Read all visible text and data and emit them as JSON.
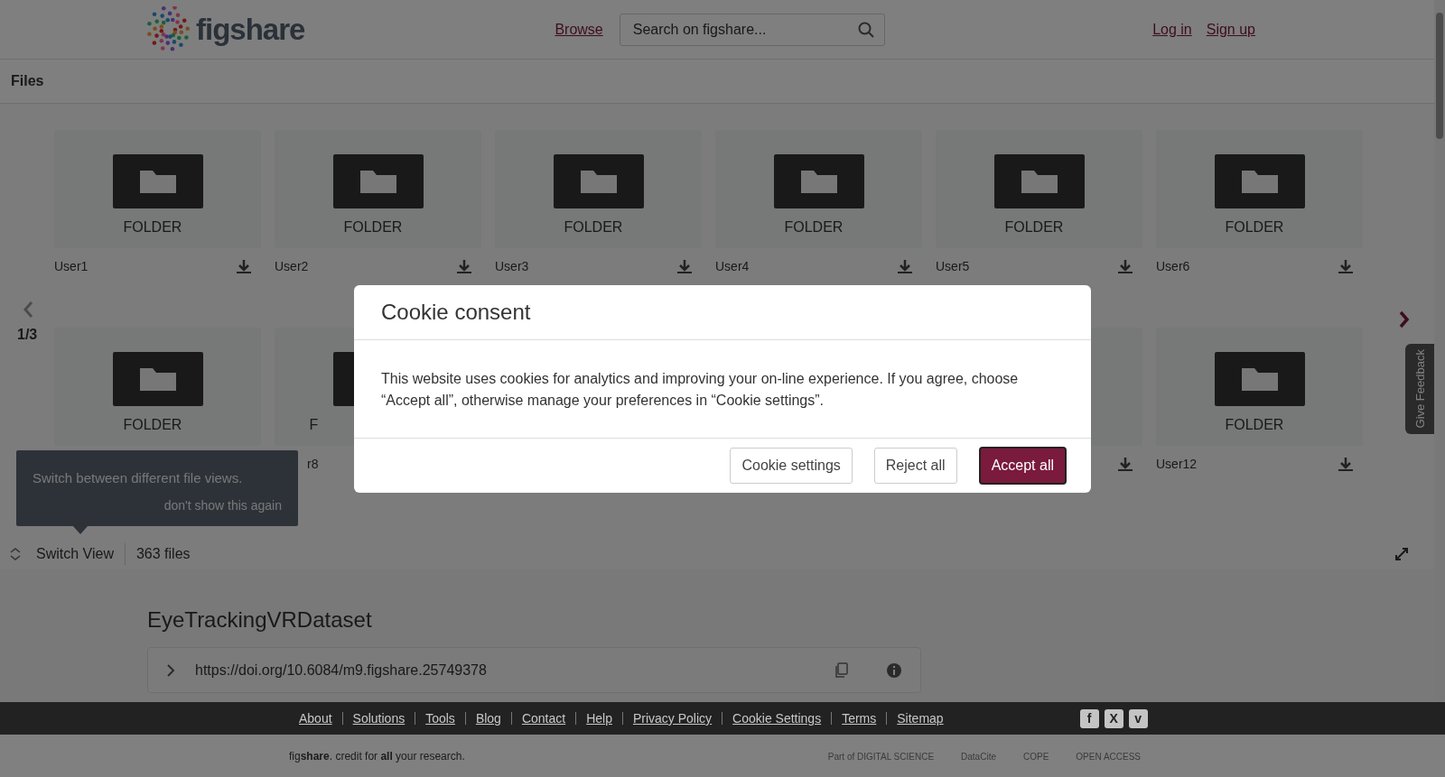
{
  "header": {
    "logo_text": "figshare",
    "nav_link": "Browse",
    "search": {
      "placeholder": "Search on figshare..."
    },
    "auth_links": [
      "Log in",
      "Sign up"
    ]
  },
  "files_bar": {
    "title": "Files"
  },
  "carousel": {
    "page": "1/3",
    "rows": [
      [
        {
          "kind": "folder",
          "caption": "FOLDER",
          "label": "User1",
          "download": true
        },
        {
          "kind": "folder",
          "caption": "FOLDER",
          "label": "User2",
          "download": true
        },
        {
          "kind": "folder",
          "caption": "FOLDER",
          "label": "User3",
          "download": true
        },
        {
          "kind": "folder",
          "caption": "FOLDER",
          "label": "User4",
          "download": true
        },
        {
          "kind": "folder",
          "caption": "FOLDER",
          "label": "User5",
          "download": true
        },
        {
          "kind": "folder",
          "caption": "FOLDER",
          "label": "User6",
          "download": true
        }
      ],
      [
        {
          "kind": "folder",
          "caption": "FOLDER"
        },
        {
          "kind": "folder-clipped",
          "caption": "F",
          "label": "r8"
        },
        {
          "kind": "hidden"
        },
        {
          "kind": "hidden"
        },
        {
          "kind": "blank",
          "download": true
        },
        {
          "kind": "folder",
          "caption": "FOLDER",
          "label": "User12",
          "download": true
        }
      ]
    ]
  },
  "tooltip": {
    "text": "Switch between different file views.",
    "dismiss": "don't show this again"
  },
  "view_bar": {
    "switch_label": "Switch View",
    "count": "363 files"
  },
  "feedback_tab": "Give Feedback",
  "dataset": {
    "title": "EyeTrackingVRDataset",
    "doi": "https://doi.org/10.6084/m9.figshare.25749378"
  },
  "footer": {
    "links": [
      "About",
      "Solutions",
      "Tools",
      "Blog",
      "Contact",
      "Help",
      "Privacy Policy",
      "Cookie Settings",
      "Terms",
      "Sitemap"
    ],
    "social": [
      "f",
      "X",
      "v"
    ],
    "tagline": "fig**share**. credit for **all** your research.",
    "partners": [
      "Part of DIGITAL SCIENCE",
      "DataCite",
      "COPE",
      "OPEN ACCESS"
    ]
  },
  "cookie_modal": {
    "title": "Cookie consent",
    "body": "This website uses cookies for analytics and improving your on-line experience. If you agree, choose “Accept all”, otherwise manage your preferences in “Cookie settings”.",
    "buttons": [
      {
        "label": "Cookie settings",
        "primary": false
      },
      {
        "label": "Reject all",
        "primary": false
      },
      {
        "label": "Accept all",
        "primary": true
      }
    ]
  }
}
